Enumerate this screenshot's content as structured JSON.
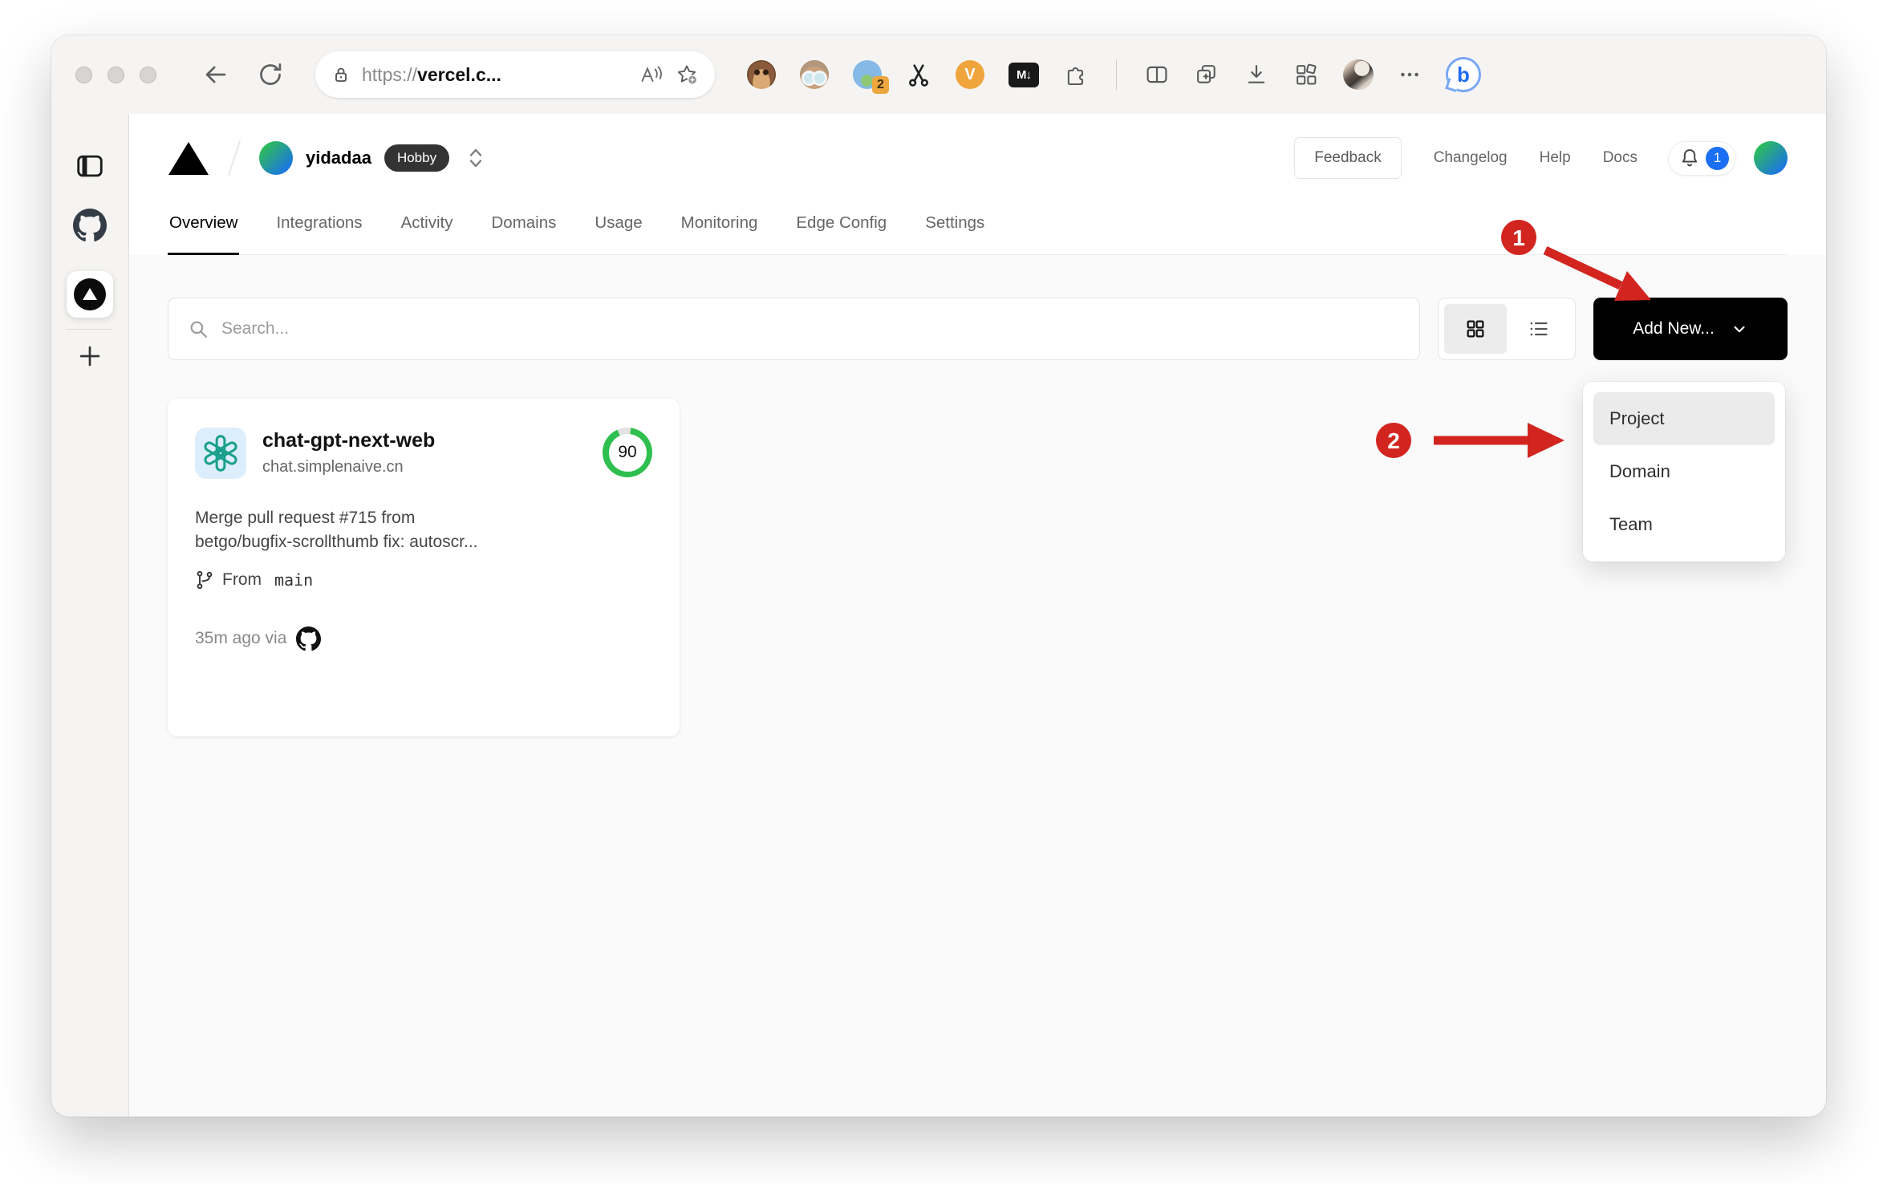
{
  "browser": {
    "url_scheme": "https://",
    "url_host": "vercel.c...",
    "extensions": {
      "blob_badge_count": "2",
      "v_label": "V",
      "markdown_label": "M↓",
      "bing_label": "b"
    }
  },
  "sidebar": {
    "items": [
      "sidebar-toggle",
      "github",
      "vercel",
      "add-new"
    ]
  },
  "header": {
    "team_name": "yidadaa",
    "plan_badge": "Hobby",
    "feedback_label": "Feedback",
    "links": [
      "Changelog",
      "Help",
      "Docs"
    ],
    "notification_count": "1"
  },
  "tabs": [
    {
      "label": "Overview",
      "active": true
    },
    {
      "label": "Integrations"
    },
    {
      "label": "Activity"
    },
    {
      "label": "Domains"
    },
    {
      "label": "Usage"
    },
    {
      "label": "Monitoring"
    },
    {
      "label": "Edge Config"
    },
    {
      "label": "Settings"
    }
  ],
  "toolbar": {
    "search_placeholder": "Search...",
    "add_new_label": "Add New..."
  },
  "dropdown": {
    "items": [
      {
        "label": "Project",
        "highlighted": true
      },
      {
        "label": "Domain"
      },
      {
        "label": "Team"
      }
    ]
  },
  "project_card": {
    "name": "chat-gpt-next-web",
    "domain": "chat.simplenaive.cn",
    "score": "90",
    "commit_line1": "Merge pull request #715 from",
    "commit_line2": "betgo/bugfix-scrollthumb fix: autoscr...",
    "branch_prefix": "From",
    "branch_name": "main",
    "deployed_text": "35m ago via"
  },
  "annotations": {
    "step1": "1",
    "step2": "2"
  },
  "colors": {
    "annotation_red": "#d2251f",
    "score_green": "#2fbf4f",
    "notification_blue": "#1a6ff3",
    "accent_black": "#000000",
    "openai_teal": "#1aa08c",
    "body_gray": "#fafafa"
  }
}
